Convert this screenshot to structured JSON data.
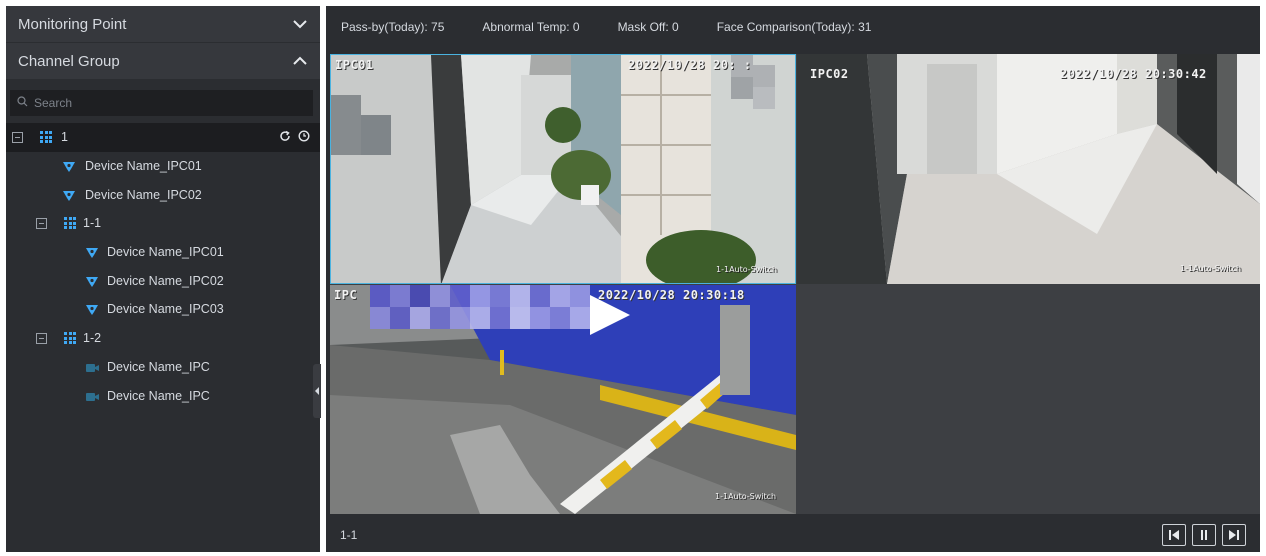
{
  "sidebar": {
    "monitoring_point_label": "Monitoring Point",
    "channel_group_label": "Channel Group",
    "search_placeholder": "Search",
    "tree": {
      "root_label": "1",
      "root_devices": [
        "Device Name_IPC01",
        "Device Name_IPC02"
      ],
      "group_1_1_label": "1-1",
      "group_1_1_devices": [
        "Device Name_IPC01",
        "Device Name_IPC02",
        "Device Name_IPC03"
      ],
      "group_1_2_label": "1-2",
      "group_1_2_devices": [
        "Device Name_IPC",
        "Device Name_IPC"
      ]
    }
  },
  "stats": {
    "pass_by": "Pass-by(Today): 75",
    "abnormal_temp": "Abnormal Temp: 0",
    "mask_off": "Mask Off: 0",
    "face_comparison": "Face Comparison(Today): 31"
  },
  "tiles": {
    "t1": {
      "cam": "IPC01",
      "time": "2022/10/28 20:  :  ",
      "corner": "1-1Auto-Switch"
    },
    "t2": {
      "cam": "IPC02",
      "time": "2022/10/28 20:30:42",
      "corner": "1-1Auto-Switch"
    },
    "t3": {
      "cam": "IPC",
      "time": "2022/10/28 20:30:18",
      "corner": "1-1Auto-Switch"
    }
  },
  "footer": {
    "group_label": "1-1"
  },
  "colors": {
    "accent": "#3fa9f5",
    "panel": "#2b2d31",
    "selected_tile_border": "#4ab3e0"
  },
  "icons": {
    "monitoring_toggle": "chevron-down-icon",
    "channel_toggle": "chevron-up-icon",
    "search": "search-icon",
    "group": "grid-group-icon",
    "camera_online": "camera-icon",
    "camera_offline": "camera-offline-icon",
    "refresh": "refresh-icon",
    "clock": "clock-icon",
    "prev": "skip-previous-icon",
    "pause": "pause-icon",
    "next": "skip-next-icon"
  }
}
